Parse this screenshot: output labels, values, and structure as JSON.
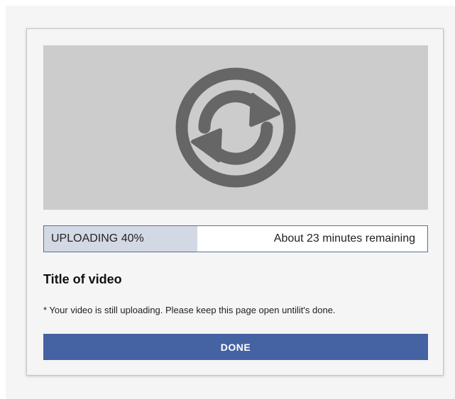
{
  "thumbnail": {
    "icon": "sync-icon",
    "icon_color": "#666666",
    "background": "#cccccc"
  },
  "progress": {
    "label": "UPLOADING 40%",
    "percent": 40,
    "remaining": "About 23 minutes remaining",
    "fill_color": "#d3d9e4",
    "border_color": "#5a6f9e"
  },
  "video": {
    "title": "Title of video",
    "note": "* Your video is still uploading. Please keep this page open untilit's done."
  },
  "actions": {
    "done_label": "DONE",
    "done_color": "#4563a3"
  }
}
